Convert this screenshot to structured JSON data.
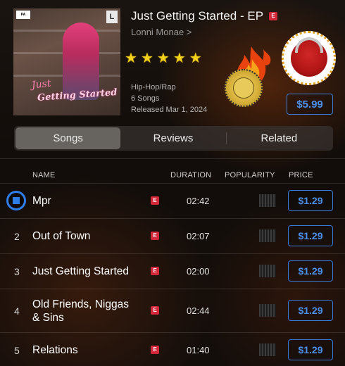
{
  "album": {
    "title": "Just Getting Started - EP",
    "explicit_mark": "E",
    "artist": "Lonni Monae",
    "artist_chevron": ">",
    "rating_stars": 5,
    "genre": "Hip-Hop/Rap",
    "song_count": "6 Songs",
    "released": "Released Mar 1, 2024",
    "price": "$5.99",
    "cover": {
      "advisory_label": "PARENTAL ADVISORY",
      "corner_logo": "L",
      "script_line1": "Just",
      "script_line2": "Getting Started"
    }
  },
  "tabs": [
    {
      "label": "Songs",
      "active": true
    },
    {
      "label": "Reviews",
      "active": false
    },
    {
      "label": "Related",
      "active": false
    }
  ],
  "table": {
    "headers": {
      "name": "NAME",
      "duration": "DURATION",
      "popularity": "POPULARITY",
      "price": "PRICE"
    },
    "rows": [
      {
        "num": "",
        "name": "Mpr",
        "explicit": "E",
        "duration": "02:42",
        "price": "$1.29",
        "playing": true
      },
      {
        "num": "2",
        "name": "Out of Town",
        "explicit": "E",
        "duration": "02:07",
        "price": "$1.29",
        "playing": false
      },
      {
        "num": "3",
        "name": "Just Getting Started",
        "explicit": "E",
        "duration": "02:00",
        "price": "$1.29",
        "playing": false
      },
      {
        "num": "4",
        "name": "Old Friends, Niggas",
        "name_line2": "& Sins",
        "explicit": "E",
        "duration": "02:44",
        "price": "$1.29",
        "playing": false
      },
      {
        "num": "5",
        "name": "Relations",
        "explicit": "E",
        "duration": "01:40",
        "price": "$1.29",
        "playing": false
      }
    ]
  },
  "colors": {
    "accent_blue": "#3a7bd5",
    "explicit_red": "#d3283a",
    "star_gold": "#f3d21b"
  },
  "icons": {
    "playing": "stop-icon",
    "popularity": "popularity-bars-icon",
    "rating": "star-icon"
  }
}
